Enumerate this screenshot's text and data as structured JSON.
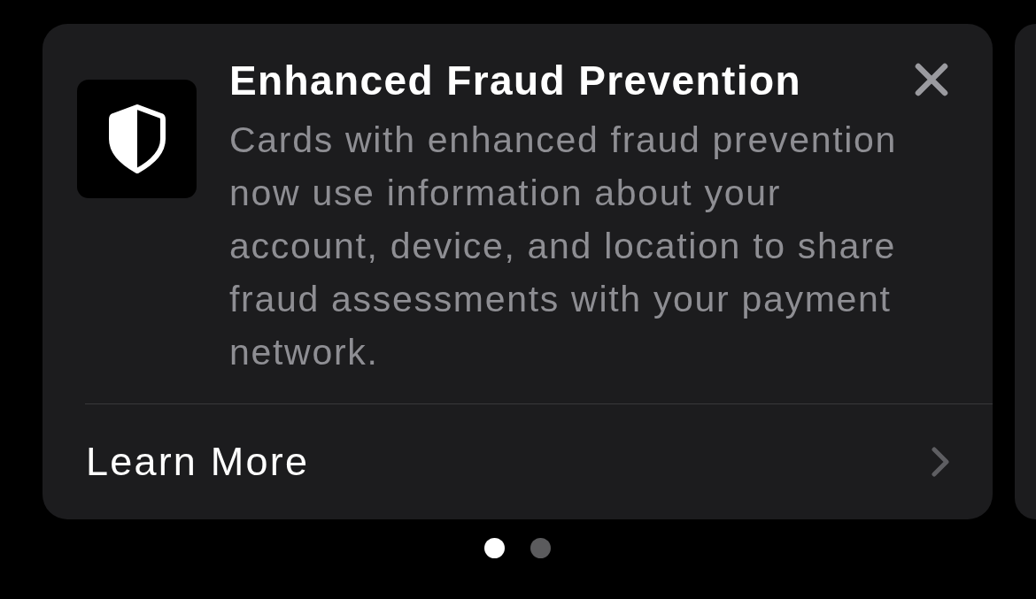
{
  "card": {
    "title": "Enhanced Fraud Prevention",
    "body": "Cards with enhanced fraud prevention now use information about your account, device, and location to share fraud assessments with your payment network.",
    "link": "Learn More"
  },
  "page_dots": [
    {
      "selected": true
    },
    {
      "selected": false
    }
  ]
}
